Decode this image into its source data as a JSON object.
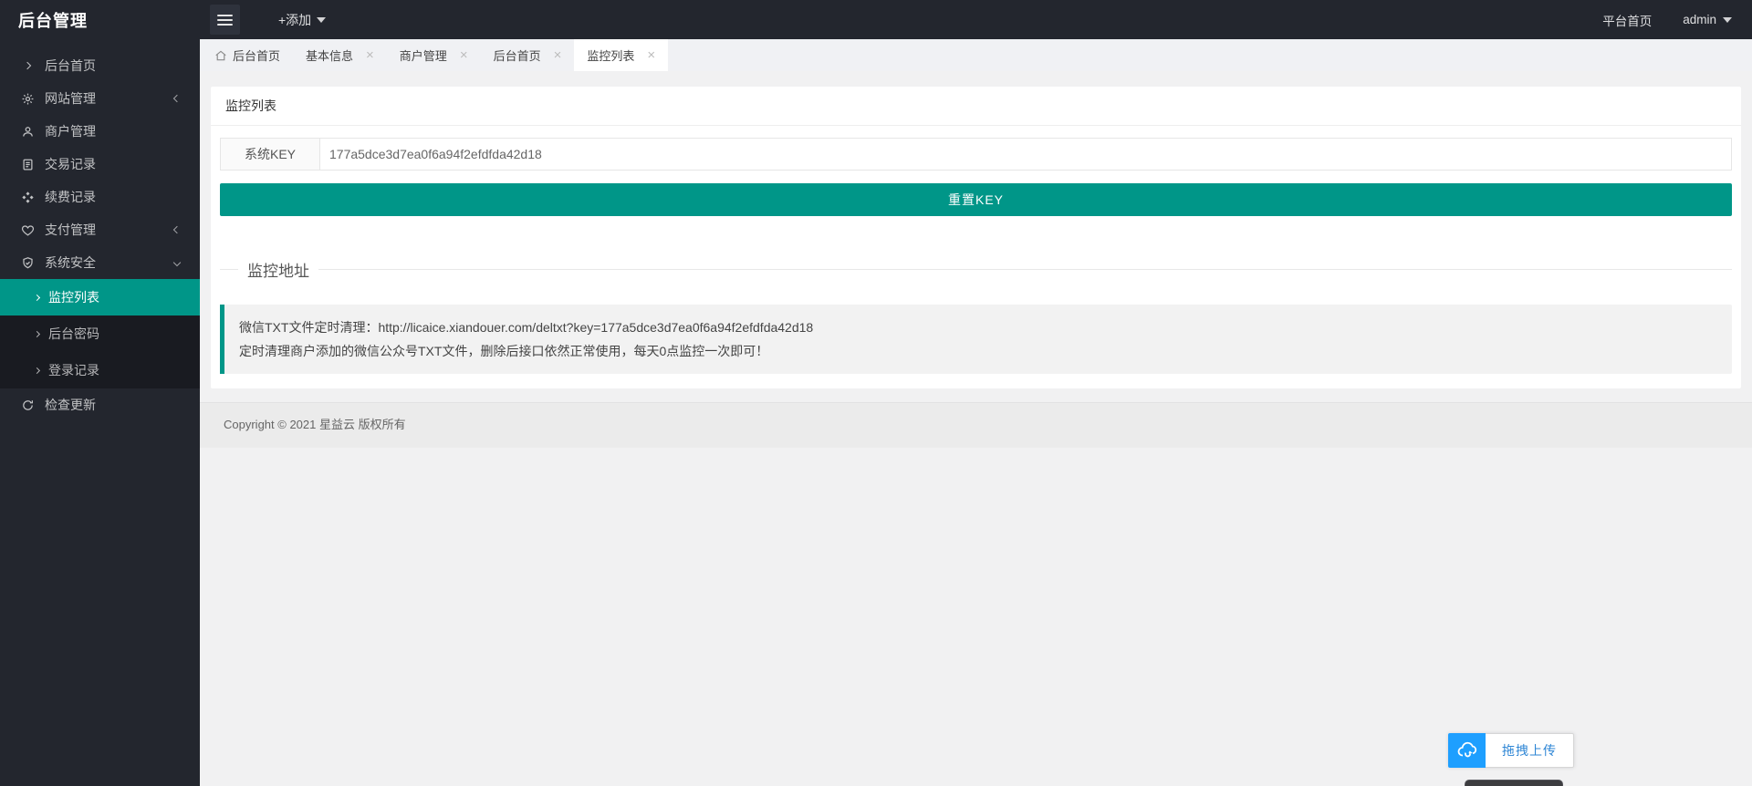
{
  "app": {
    "title": "后台管理"
  },
  "header": {
    "add_label": "+添加",
    "platform_home": "平台首页",
    "username": "admin"
  },
  "sidebar": {
    "items": [
      {
        "label": "后台首页",
        "icon": "chevron-right-icon"
      },
      {
        "label": "网站管理",
        "icon": "gear-icon",
        "state": "collapsed"
      },
      {
        "label": "商户管理",
        "icon": "user-icon"
      },
      {
        "label": "交易记录",
        "icon": "document-icon"
      },
      {
        "label": "续费记录",
        "icon": "components-icon"
      },
      {
        "label": "支付管理",
        "icon": "heart-icon",
        "state": "collapsed"
      },
      {
        "label": "系统安全",
        "icon": "shield-icon",
        "state": "expanded",
        "children": [
          "监控列表",
          "后台密码",
          "登录记录"
        ],
        "active_child": "监控列表"
      },
      {
        "label": "检查更新",
        "icon": "refresh-icon"
      }
    ]
  },
  "tabs": [
    {
      "label": "后台首页",
      "icon": "home-icon",
      "closable": false,
      "active": false
    },
    {
      "label": "基本信息",
      "closable": true,
      "active": false
    },
    {
      "label": "商户管理",
      "closable": true,
      "active": false
    },
    {
      "label": "后台首页",
      "closable": true,
      "active": false
    },
    {
      "label": "监控列表",
      "closable": true,
      "active": true
    }
  ],
  "tab_close_glyph": "×",
  "main": {
    "card_title": "监控列表",
    "form": {
      "key_label": "系统KEY",
      "key_value": "177a5dce3d7ea0f6a94f2efdfda42d18"
    },
    "reset_button": "重置KEY",
    "section_title": "监控地址",
    "notice_line1": "微信TXT文件定时清理：http://licaice.xiandouer.com/deltxt?key=177a5dce3d7ea0f6a94f2efdfda42d18",
    "notice_line2": "定时清理商户添加的微信公众号TXT文件，删除后接口依然正常使用，每天0点监控一次即可！"
  },
  "footer": {
    "copyright": "Copyright © 2021 星益云 版权所有"
  },
  "upload": {
    "drag_label": "拖拽上传",
    "icon": "cloud-upload-icon"
  },
  "colors": {
    "accent": "#009688",
    "blue": "#1E9FFF",
    "dark": "#23262e"
  }
}
